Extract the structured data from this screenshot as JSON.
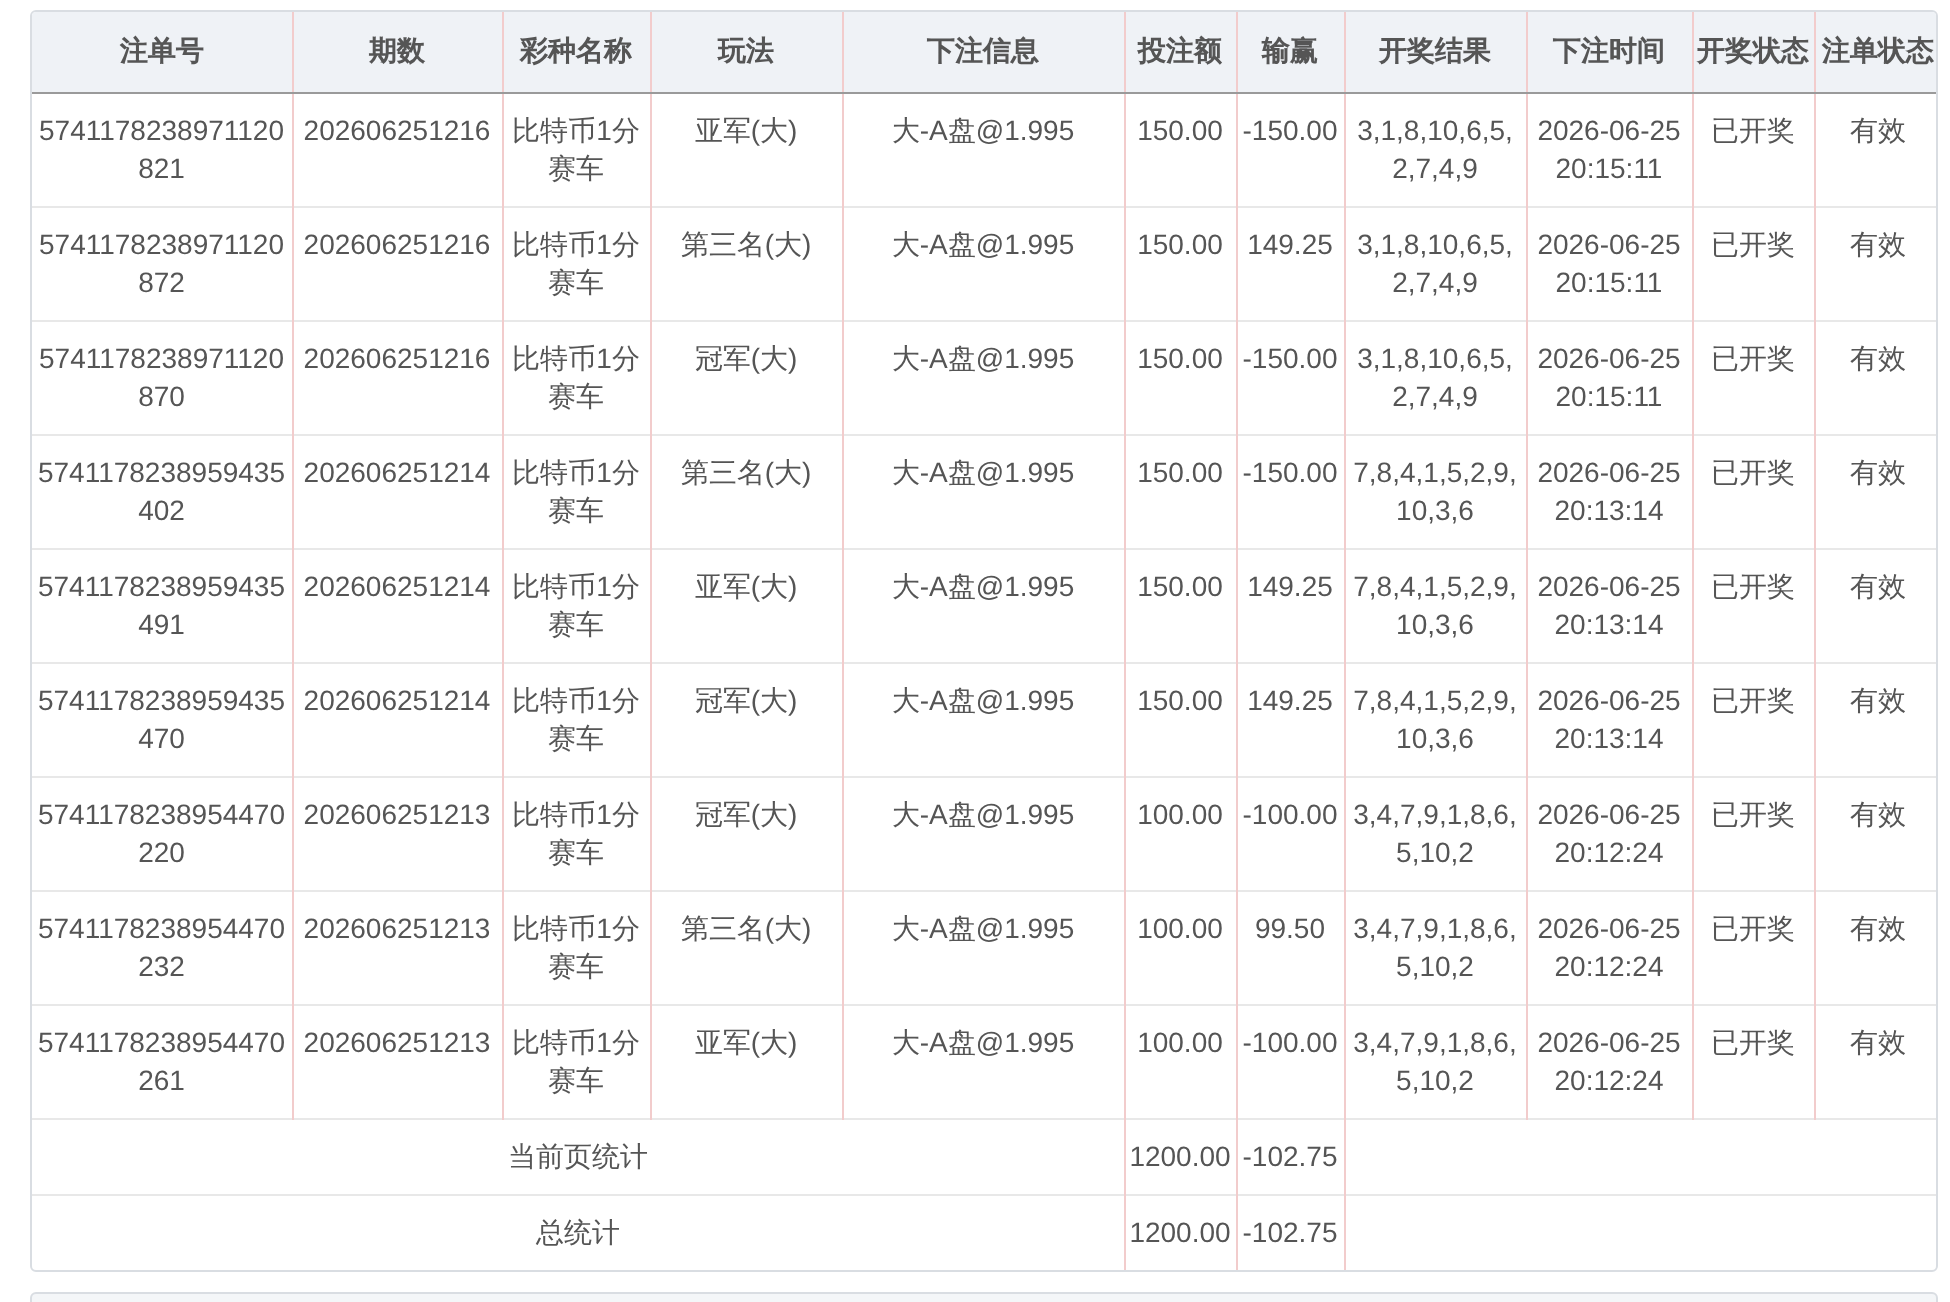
{
  "table": {
    "columns": [
      "注单号",
      "期数",
      "彩种名称",
      "玩法",
      "下注信息",
      "投注额",
      "输赢",
      "开奖结果",
      "下注时间",
      "开奖状态",
      "注单状态"
    ],
    "rows": [
      {
        "bet_id": "5741178238971120821",
        "issue": "202606251216",
        "lottery": "比特币1分赛车",
        "play": "亚军(大)",
        "bet_info": "大-A盘@1.995",
        "amount": "150.00",
        "profit": "-150.00",
        "result": "3,1,8,10,6,5,2,7,4,9",
        "time": "2026-06-25 20:15:11",
        "draw_status": "已开奖",
        "order_status": "有效"
      },
      {
        "bet_id": "5741178238971120872",
        "issue": "202606251216",
        "lottery": "比特币1分赛车",
        "play": "第三名(大)",
        "bet_info": "大-A盘@1.995",
        "amount": "150.00",
        "profit": "149.25",
        "result": "3,1,8,10,6,5,2,7,4,9",
        "time": "2026-06-25 20:15:11",
        "draw_status": "已开奖",
        "order_status": "有效"
      },
      {
        "bet_id": "5741178238971120870",
        "issue": "202606251216",
        "lottery": "比特币1分赛车",
        "play": "冠军(大)",
        "bet_info": "大-A盘@1.995",
        "amount": "150.00",
        "profit": "-150.00",
        "result": "3,1,8,10,6,5,2,7,4,9",
        "time": "2026-06-25 20:15:11",
        "draw_status": "已开奖",
        "order_status": "有效"
      },
      {
        "bet_id": "5741178238959435402",
        "issue": "202606251214",
        "lottery": "比特币1分赛车",
        "play": "第三名(大)",
        "bet_info": "大-A盘@1.995",
        "amount": "150.00",
        "profit": "-150.00",
        "result": "7,8,4,1,5,2,9,10,3,6",
        "time": "2026-06-25 20:13:14",
        "draw_status": "已开奖",
        "order_status": "有效"
      },
      {
        "bet_id": "5741178238959435491",
        "issue": "202606251214",
        "lottery": "比特币1分赛车",
        "play": "亚军(大)",
        "bet_info": "大-A盘@1.995",
        "amount": "150.00",
        "profit": "149.25",
        "result": "7,8,4,1,5,2,9,10,3,6",
        "time": "2026-06-25 20:13:14",
        "draw_status": "已开奖",
        "order_status": "有效"
      },
      {
        "bet_id": "5741178238959435470",
        "issue": "202606251214",
        "lottery": "比特币1分赛车",
        "play": "冠军(大)",
        "bet_info": "大-A盘@1.995",
        "amount": "150.00",
        "profit": "149.25",
        "result": "7,8,4,1,5,2,9,10,3,6",
        "time": "2026-06-25 20:13:14",
        "draw_status": "已开奖",
        "order_status": "有效"
      },
      {
        "bet_id": "5741178238954470220",
        "issue": "202606251213",
        "lottery": "比特币1分赛车",
        "play": "冠军(大)",
        "bet_info": "大-A盘@1.995",
        "amount": "100.00",
        "profit": "-100.00",
        "result": "3,4,7,9,1,8,6,5,10,2",
        "time": "2026-06-25 20:12:24",
        "draw_status": "已开奖",
        "order_status": "有效"
      },
      {
        "bet_id": "5741178238954470232",
        "issue": "202606251213",
        "lottery": "比特币1分赛车",
        "play": "第三名(大)",
        "bet_info": "大-A盘@1.995",
        "amount": "100.00",
        "profit": "99.50",
        "result": "3,4,7,9,1,8,6,5,10,2",
        "time": "2026-06-25 20:12:24",
        "draw_status": "已开奖",
        "order_status": "有效"
      },
      {
        "bet_id": "5741178238954470261",
        "issue": "202606251213",
        "lottery": "比特币1分赛车",
        "play": "亚军(大)",
        "bet_info": "大-A盘@1.995",
        "amount": "100.00",
        "profit": "-100.00",
        "result": "3,4,7,9,1,8,6,5,10,2",
        "time": "2026-06-25 20:12:24",
        "draw_status": "已开奖",
        "order_status": "有效"
      }
    ],
    "summary": [
      {
        "label": "当前页统计",
        "amount": "1200.00",
        "profit": "-102.75"
      },
      {
        "label": "总统计",
        "amount": "1200.00",
        "profit": "-102.75"
      }
    ]
  }
}
